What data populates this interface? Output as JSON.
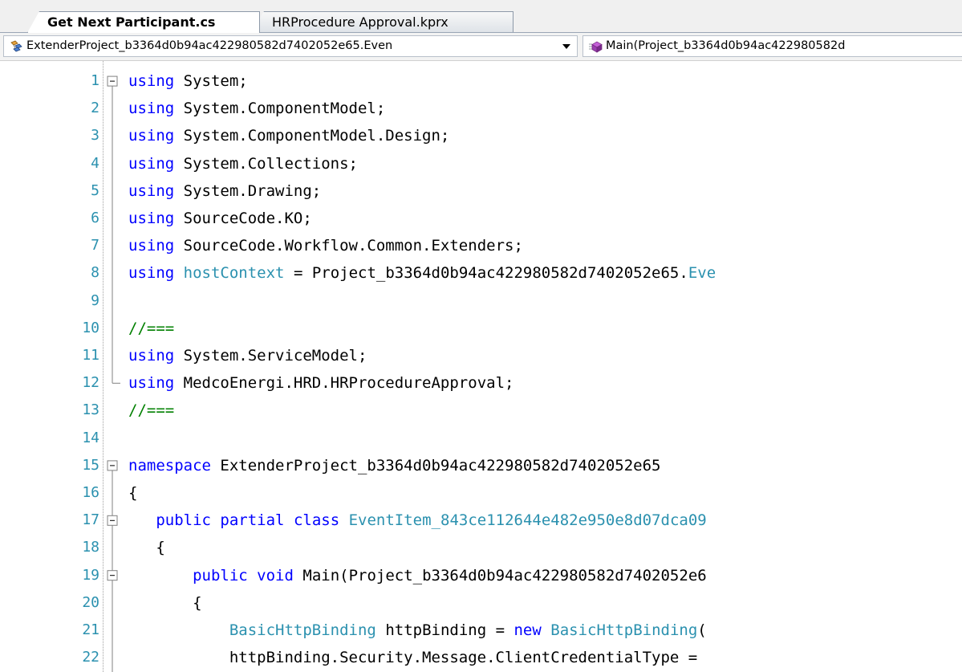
{
  "tabs": [
    {
      "label": "Get Next Participant.cs",
      "active": true
    },
    {
      "label": "HRProcedure Approval.kprx",
      "active": false
    }
  ],
  "navbar": {
    "type_dropdown": "ExtenderProject_b3364d0b94ac422980582d7402052e65.Even",
    "member_dropdown": "Main(Project_b3364d0b94ac422980582d"
  },
  "icons": {
    "type_icon": "class-icon",
    "member_icon": "method-icon",
    "arrow": "chevron-down-icon"
  },
  "colors": {
    "keyword": "#0000ff",
    "type": "#2b91af",
    "comment": "#008000",
    "line_number": "#2b91af"
  },
  "lines": [
    {
      "n": "1",
      "tokens": [
        [
          "kw",
          "using"
        ],
        [
          "",
          "  System;"
        ]
      ],
      "fold": "minus"
    },
    {
      "n": "2",
      "tokens": [
        [
          "kw",
          "using"
        ],
        [
          "",
          "  System.ComponentModel;"
        ]
      ]
    },
    {
      "n": "3",
      "tokens": [
        [
          "kw",
          "using"
        ],
        [
          "",
          "  System.ComponentModel.Design;"
        ]
      ]
    },
    {
      "n": "4",
      "tokens": [
        [
          "kw",
          "using"
        ],
        [
          "",
          "  System.Collections;"
        ]
      ]
    },
    {
      "n": "5",
      "tokens": [
        [
          "kw",
          "using"
        ],
        [
          "",
          "  System.Drawing;"
        ]
      ]
    },
    {
      "n": "6",
      "tokens": [
        [
          "kw",
          "using"
        ],
        [
          "",
          "  SourceCode.KO;"
        ]
      ]
    },
    {
      "n": "7",
      "tokens": [
        [
          "kw",
          "using"
        ],
        [
          "",
          "  SourceCode.Workflow.Common.Extenders;"
        ]
      ]
    },
    {
      "n": "8",
      "tokens": [
        [
          "kw",
          "using"
        ],
        [
          "",
          "  "
        ],
        [
          "ty",
          "hostContext"
        ],
        [
          "",
          " = Project_b3364d0b94ac422980582d7402052e65."
        ],
        [
          "ty",
          "Eve"
        ]
      ]
    },
    {
      "n": "9",
      "tokens": []
    },
    {
      "n": "10",
      "tokens": [
        [
          "cm",
          "//==="
        ]
      ]
    },
    {
      "n": "11",
      "tokens": [
        [
          "kw",
          "using"
        ],
        [
          "",
          "  System.ServiceModel;"
        ]
      ]
    },
    {
      "n": "12",
      "tokens": [
        [
          "kw",
          "using"
        ],
        [
          "",
          "  MedcoEnergi.HRD.HRProcedureApproval;"
        ]
      ],
      "fold": "end"
    },
    {
      "n": "13",
      "tokens": [
        [
          "cm",
          "//==="
        ]
      ]
    },
    {
      "n": "14",
      "tokens": []
    },
    {
      "n": "15",
      "tokens": [
        [
          "kw",
          "namespace"
        ],
        [
          "",
          " ExtenderProject_b3364d0b94ac422980582d7402052e65"
        ]
      ],
      "fold": "minus"
    },
    {
      "n": "16",
      "tokens": [
        [
          "",
          "{"
        ]
      ]
    },
    {
      "n": "17",
      "tokens": [
        [
          "",
          "    "
        ],
        [
          "kw",
          "public"
        ],
        [
          "",
          " "
        ],
        [
          "kw",
          "partial"
        ],
        [
          "",
          " "
        ],
        [
          "kw",
          "class"
        ],
        [
          "",
          " "
        ],
        [
          "ty",
          "EventItem_843ce112644e482e950e8d07dca09"
        ]
      ],
      "fold": "minus"
    },
    {
      "n": "18",
      "tokens": [
        [
          "",
          "    {"
        ]
      ]
    },
    {
      "n": "19",
      "tokens": [
        [
          "",
          "        "
        ],
        [
          "kw",
          "public"
        ],
        [
          "",
          " "
        ],
        [
          "kw",
          "void"
        ],
        [
          "",
          " Main(Project_b3364d0b94ac422980582d7402052e6"
        ]
      ],
      "fold": "minus"
    },
    {
      "n": "20",
      "tokens": [
        [
          "",
          "        {"
        ]
      ]
    },
    {
      "n": "21",
      "tokens": [
        [
          "",
          "            "
        ],
        [
          "ty",
          "BasicHttpBinding"
        ],
        [
          "",
          " httpBinding = "
        ],
        [
          "kw",
          "new"
        ],
        [
          "",
          " "
        ],
        [
          "ty",
          "BasicHttpBinding"
        ],
        [
          "",
          "("
        ]
      ]
    },
    {
      "n": "22",
      "tokens": [
        [
          "",
          "            httpBinding.Security.Message.ClientCredentialType = "
        ]
      ]
    }
  ]
}
